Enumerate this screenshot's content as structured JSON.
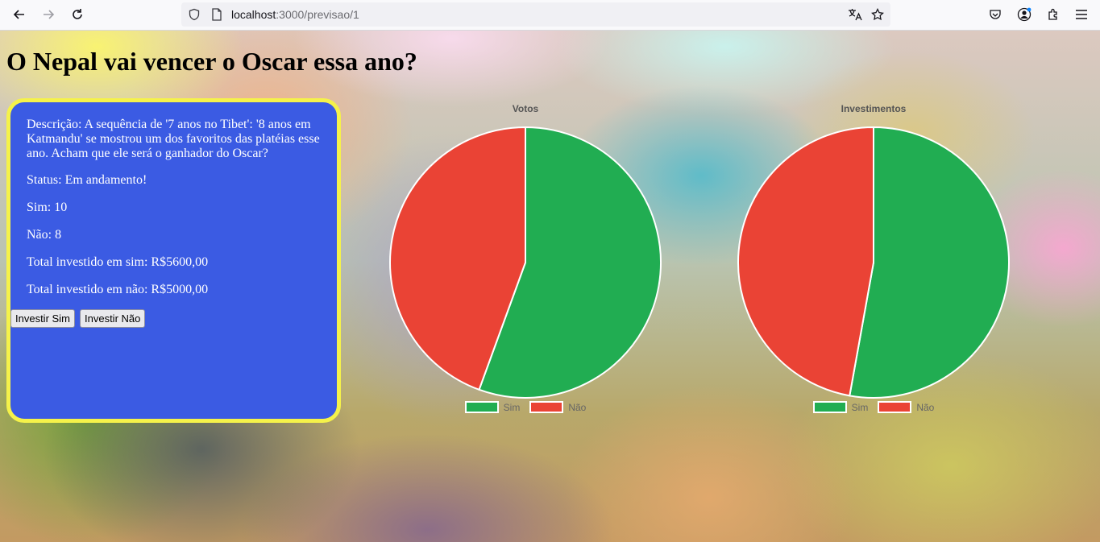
{
  "browser": {
    "url_host": "localhost",
    "url_path": ":3000/previsao/1"
  },
  "page": {
    "title": "O Nepal vai vencer o Oscar essa ano?"
  },
  "card": {
    "description": "Descrição: A sequência de '7 anos no Tibet': '8 anos em Katmandu' se mostrou um dos favoritos das platéias esse ano. Acham que ele será o ganhador do Oscar?",
    "status": "Status: Em andamento!",
    "sim": "Sim: 10",
    "nao": "Não: 8",
    "total_sim": "Total investido em sim: R$5600,00",
    "total_nao": "Total investido em não: R$5000,00",
    "invest_sim_label": "Investir Sim",
    "invest_nao_label": "Investir Não",
    "colors": {
      "background": "#3b5be3",
      "border": "#f5f24a"
    }
  },
  "chart_data": [
    {
      "type": "pie",
      "title": "Votos",
      "categories": [
        "Sim",
        "Não"
      ],
      "values": [
        10,
        8
      ],
      "colors": [
        "#21ad52",
        "#ea4335"
      ],
      "legend": "bottom"
    },
    {
      "type": "pie",
      "title": "Investimentos",
      "categories": [
        "Sim",
        "Não"
      ],
      "values": [
        5600,
        5000
      ],
      "colors": [
        "#21ad52",
        "#ea4335"
      ],
      "legend": "bottom"
    }
  ]
}
